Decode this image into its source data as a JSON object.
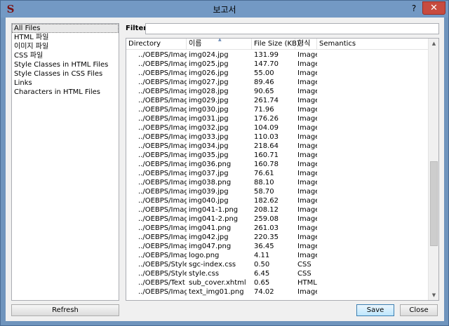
{
  "window": {
    "title": "보고서",
    "app_icon_glyph": "S",
    "help_label": "?",
    "close_glyph": "✕"
  },
  "sidebar": {
    "items": [
      {
        "label": "All Files",
        "selected": true
      },
      {
        "label": "HTML 파일"
      },
      {
        "label": "이미지 파일"
      },
      {
        "label": "CSS 파일"
      },
      {
        "label": "Style Classes in HTML Files"
      },
      {
        "label": "Style Classes in CSS Files"
      },
      {
        "label": "Links"
      },
      {
        "label": "Characters in HTML Files"
      }
    ],
    "refresh_label": "Refresh"
  },
  "filter": {
    "label": "Filter:",
    "value": ""
  },
  "table": {
    "headers": [
      "Directory",
      "이름",
      "File Size (KB)",
      "형식",
      "Semantics"
    ],
    "sort_indicator": "▲",
    "rows": [
      [
        "../OEBPS/Images",
        "img024.jpg",
        "131.99",
        "Image",
        ""
      ],
      [
        "../OEBPS/Images",
        "img025.jpg",
        "147.70",
        "Image",
        ""
      ],
      [
        "../OEBPS/Images",
        "img026.jpg",
        "55.00",
        "Image",
        ""
      ],
      [
        "../OEBPS/Images",
        "img027.jpg",
        "89.46",
        "Image",
        ""
      ],
      [
        "../OEBPS/Images",
        "img028.jpg",
        "90.65",
        "Image",
        ""
      ],
      [
        "../OEBPS/Images",
        "img029.jpg",
        "261.74",
        "Image",
        ""
      ],
      [
        "../OEBPS/Images",
        "img030.jpg",
        "71.96",
        "Image",
        ""
      ],
      [
        "../OEBPS/Images",
        "img031.jpg",
        "176.26",
        "Image",
        ""
      ],
      [
        "../OEBPS/Images",
        "img032.jpg",
        "104.09",
        "Image",
        ""
      ],
      [
        "../OEBPS/Images",
        "img033.jpg",
        "110.03",
        "Image",
        ""
      ],
      [
        "../OEBPS/Images",
        "img034.jpg",
        "218.64",
        "Image",
        ""
      ],
      [
        "../OEBPS/Images",
        "img035.jpg",
        "160.71",
        "Image",
        ""
      ],
      [
        "../OEBPS/Images",
        "img036.png",
        "160.78",
        "Image",
        ""
      ],
      [
        "../OEBPS/Images",
        "img037.jpg",
        "76.61",
        "Image",
        ""
      ],
      [
        "../OEBPS/Images",
        "img038.png",
        "88.10",
        "Image",
        ""
      ],
      [
        "../OEBPS/Images",
        "img039.jpg",
        "58.70",
        "Image",
        ""
      ],
      [
        "../OEBPS/Images",
        "img040.jpg",
        "182.62",
        "Image",
        ""
      ],
      [
        "../OEBPS/Images",
        "img041-1.png",
        "208.12",
        "Image",
        ""
      ],
      [
        "../OEBPS/Images",
        "img041-2.png",
        "259.08",
        "Image",
        ""
      ],
      [
        "../OEBPS/Images",
        "img041.png",
        "261.03",
        "Image",
        ""
      ],
      [
        "../OEBPS/Images",
        "img042.jpg",
        "220.35",
        "Image",
        ""
      ],
      [
        "../OEBPS/Images",
        "img047.png",
        "36.45",
        "Image",
        ""
      ],
      [
        "../OEBPS/Images",
        "logo.png",
        "4.11",
        "Image",
        ""
      ],
      [
        "../OEBPS/Styles",
        "sgc-index.css",
        "0.50",
        "CSS",
        ""
      ],
      [
        "../OEBPS/Styles",
        "style.css",
        "6.45",
        "CSS",
        ""
      ],
      [
        "../OEBPS/Text",
        "sub_cover.xhtml",
        "0.65",
        "HTML",
        ""
      ],
      [
        "../OEBPS/Images",
        "text_img01.png",
        "74.02",
        "Image",
        ""
      ]
    ]
  },
  "scroll": {
    "position_fraction": 0.72,
    "visible_fraction": 0.35,
    "up_glyph": "▲",
    "down_glyph": "▼"
  },
  "buttons": {
    "save_label": "Save",
    "close_label": "Close"
  }
}
